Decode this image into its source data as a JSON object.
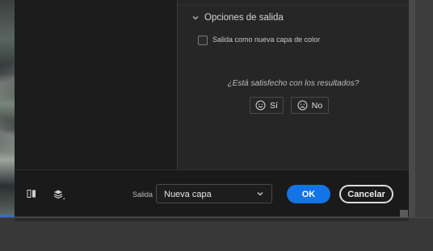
{
  "section": {
    "title": "Opciones de salida",
    "expanded": true,
    "chevron_icon": "chevron-down-icon"
  },
  "options": {
    "new_color_layer_label": "Salida como nueva capa de color",
    "new_color_layer_checked": false
  },
  "feedback": {
    "question": "¿Está satisfecho con los resultados?",
    "yes_label": "Sí",
    "yes_icon": "smile-icon",
    "no_label": "No",
    "no_icon": "frown-icon"
  },
  "footer": {
    "compare_icon": "compare-view-icon",
    "layers_icon": "layers-icon",
    "output_label": "Salida",
    "output_value": "Nueva capa",
    "ok_label": "OK",
    "cancel_label": "Cancelar"
  },
  "colors": {
    "accent": "#1473e6",
    "dialog_bg": "#1f1f1f",
    "panel_bg": "#262626"
  }
}
